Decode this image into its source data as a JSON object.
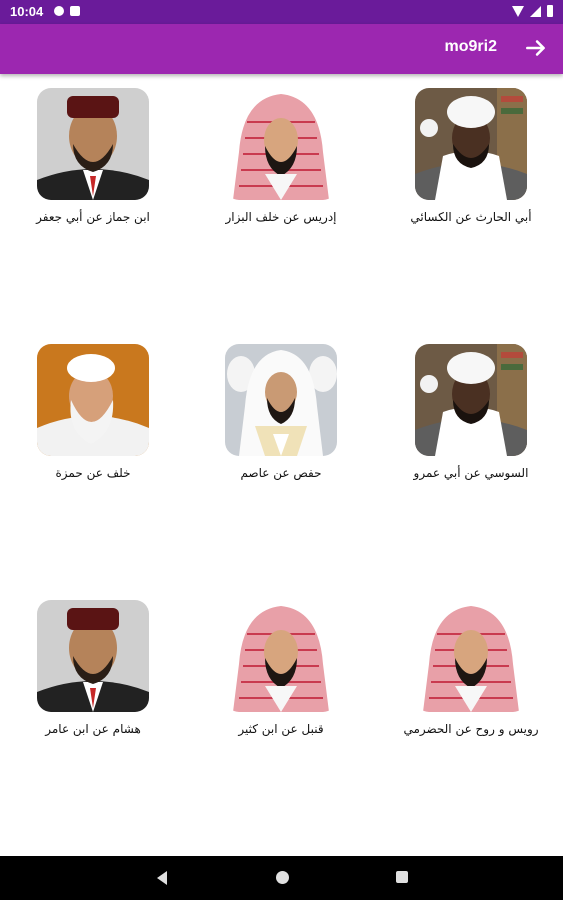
{
  "status_bar": {
    "time": "10:04",
    "icons_left": [
      "notification-icon",
      "sim-icon"
    ],
    "icons_right": [
      "wifi-icon",
      "signal-icon",
      "battery-icon"
    ]
  },
  "app_bar": {
    "title": "mo9ri2",
    "action_icon": "arrow-forward-icon",
    "color": "#9c27b0",
    "status_color": "#6a1b9a"
  },
  "reciters": [
    {
      "name": "ابن جماز عن أبي جعفر",
      "portrait": "man-red-cap"
    },
    {
      "name": "إدريس عن خلف البزار",
      "portrait": "man-shemagh"
    },
    {
      "name": "أبي الحارث عن الكسائي",
      "portrait": "man-white-turban"
    },
    {
      "name": "خلف عن حمزة",
      "portrait": "elder-white-cap"
    },
    {
      "name": "حفص عن عاصم",
      "portrait": "man-white-ghutra"
    },
    {
      "name": "السوسي عن أبي عمرو",
      "portrait": "man-white-turban"
    },
    {
      "name": "هشام عن ابن عامر",
      "portrait": "man-red-cap"
    },
    {
      "name": "قنبل عن ابن كثير",
      "portrait": "man-shemagh"
    },
    {
      "name": "رويس و روح عن الحضرمي",
      "portrait": "man-shemagh"
    }
  ],
  "nav_bar": {
    "icons": [
      "back-icon",
      "home-icon",
      "recents-icon"
    ]
  }
}
